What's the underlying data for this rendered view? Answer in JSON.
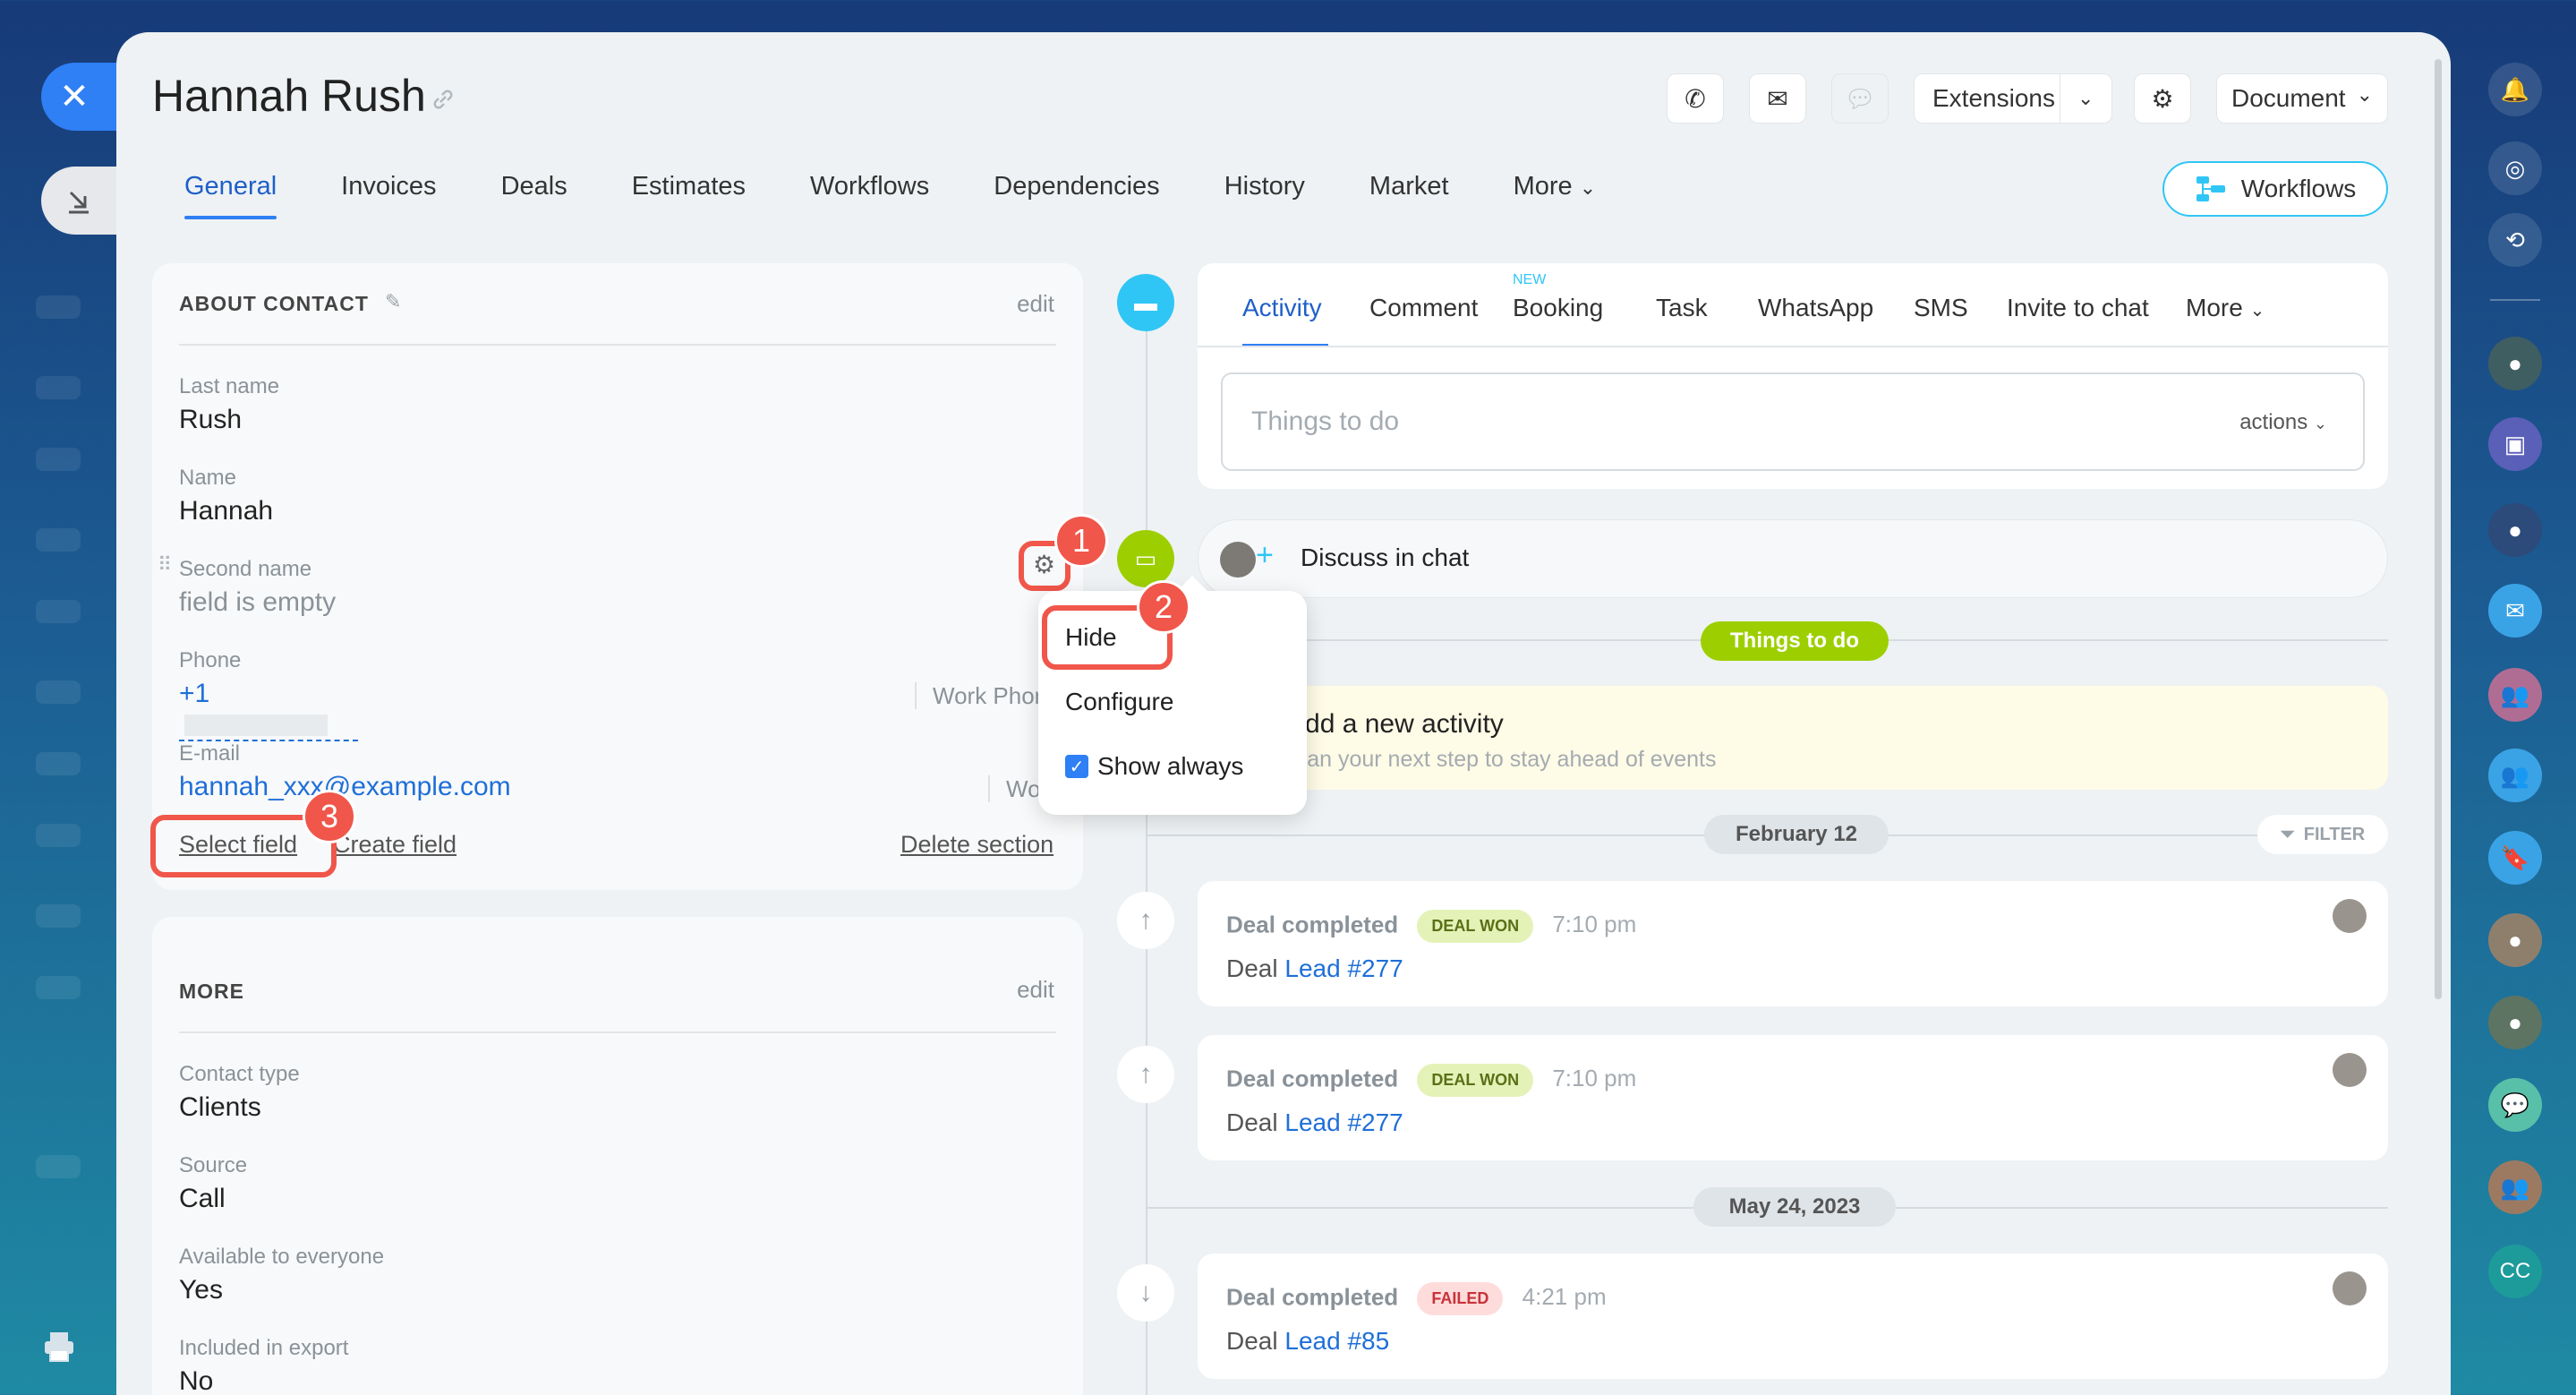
{
  "contact_name": "Hannah Rush",
  "header": {
    "extensions_label": "Extensions",
    "document_label": "Document",
    "workflows_button": "Workflows"
  },
  "tabs": [
    "General",
    "Invoices",
    "Deals",
    "Estimates",
    "Workflows",
    "Dependencies",
    "History",
    "Market",
    "More"
  ],
  "about": {
    "title": "ABOUT CONTACT",
    "edit": "edit",
    "fields": {
      "last_name_label": "Last name",
      "last_name": "Rush",
      "name_label": "Name",
      "name": "Hannah",
      "second_name_label": "Second name",
      "second_name": "field is empty",
      "phone_label": "Phone",
      "phone": "+1",
      "phone_type": "Work Phone",
      "email_label": "E-mail",
      "email": "hannah_xxx@example.com",
      "email_type": "Work"
    },
    "select_field": "Select field",
    "create_field": "Create field",
    "delete_section": "Delete section"
  },
  "more_section": {
    "title": "MORE",
    "edit": "edit",
    "contact_type_label": "Contact type",
    "contact_type": "Clients",
    "source_label": "Source",
    "source": "Call",
    "available_label": "Available to everyone",
    "available": "Yes",
    "export_label": "Included in export",
    "export": "No"
  },
  "context_menu": {
    "hide": "Hide",
    "configure": "Configure",
    "show_always": "Show always"
  },
  "annotations": [
    "1",
    "2",
    "3"
  ],
  "activity_tabs": {
    "items": [
      "Activity",
      "Comment",
      "Booking",
      "Task",
      "WhatsApp",
      "SMS",
      "Invite to chat",
      "More"
    ],
    "new_badge": "NEW"
  },
  "todo_input": {
    "placeholder": "Things to do",
    "actions": "actions"
  },
  "discuss_chat": "Discuss in chat",
  "things_todo_pill": "Things to do",
  "add_activity": {
    "title": "Add a new activity",
    "subtitle": "Plan your next step to stay ahead of events"
  },
  "date_feb": "February 12",
  "filter": "FILTER",
  "date_may": "May 24, 2023",
  "events": [
    {
      "title": "Deal completed",
      "badge": "DEAL WON",
      "time": "7:10 pm",
      "prefix": "Deal",
      "link": "Lead #277"
    },
    {
      "title": "Deal completed",
      "badge": "DEAL WON",
      "time": "7:10 pm",
      "prefix": "Deal",
      "link": "Lead #277"
    },
    {
      "title": "Deal completed",
      "badge": "FAILED",
      "time": "4:21 pm",
      "prefix": "Deal",
      "link": "Lead #85"
    }
  ],
  "rail_initials": "CC",
  "colors": {
    "accent": "#2f7ff5",
    "annotation": "#f0564a",
    "green": "#9dcf00",
    "won_badge": "#e4f2b8",
    "failed_badge": "#ffdcdc"
  }
}
